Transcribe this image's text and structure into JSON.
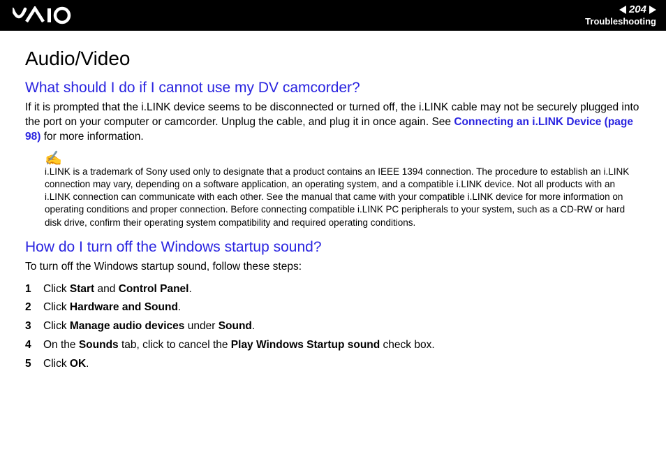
{
  "header": {
    "page_number": "204",
    "section": "Troubleshooting"
  },
  "title": "Audio/Video",
  "q1": {
    "heading": "What should I do if I cannot use my DV camcorder?",
    "body_before_link": "If it is prompted that the i.LINK device seems to be disconnected or turned off, the i.LINK cable may not be securely plugged into the port on your computer or camcorder. Unplug the cable, and plug it in once again. See ",
    "link_text": "Connecting an i.LINK Device (page 98)",
    "body_after_link": " for more information.",
    "note": "i.LINK is a trademark of Sony used only to designate that a product contains an IEEE 1394 connection. The procedure to establish an i.LINK connection may vary, depending on a software application, an operating system, and a compatible i.LINK device. Not all products with an i.LINK connection can communicate with each other. See the manual that came with your compatible i.LINK device for more information on operating conditions and proper connection. Before connecting compatible i.LINK PC peripherals to your system, such as a CD-RW or hard disk drive, confirm their operating system compatibility and required operating conditions."
  },
  "q2": {
    "heading": "How do I turn off the Windows startup sound?",
    "intro": "To turn off the Windows startup sound, follow these steps:",
    "steps": {
      "s1a": "Click ",
      "s1b": "Start",
      "s1c": " and ",
      "s1d": "Control Panel",
      "s1e": ".",
      "s2a": "Click ",
      "s2b": "Hardware and Sound",
      "s2c": ".",
      "s3a": "Click ",
      "s3b": "Manage audio devices",
      "s3c": " under ",
      "s3d": "Sound",
      "s3e": ".",
      "s4a": "On the ",
      "s4b": "Sounds",
      "s4c": " tab, click to cancel the ",
      "s4d": "Play Windows Startup sound",
      "s4e": " check box.",
      "s5a": "Click ",
      "s5b": "OK",
      "s5c": "."
    }
  }
}
